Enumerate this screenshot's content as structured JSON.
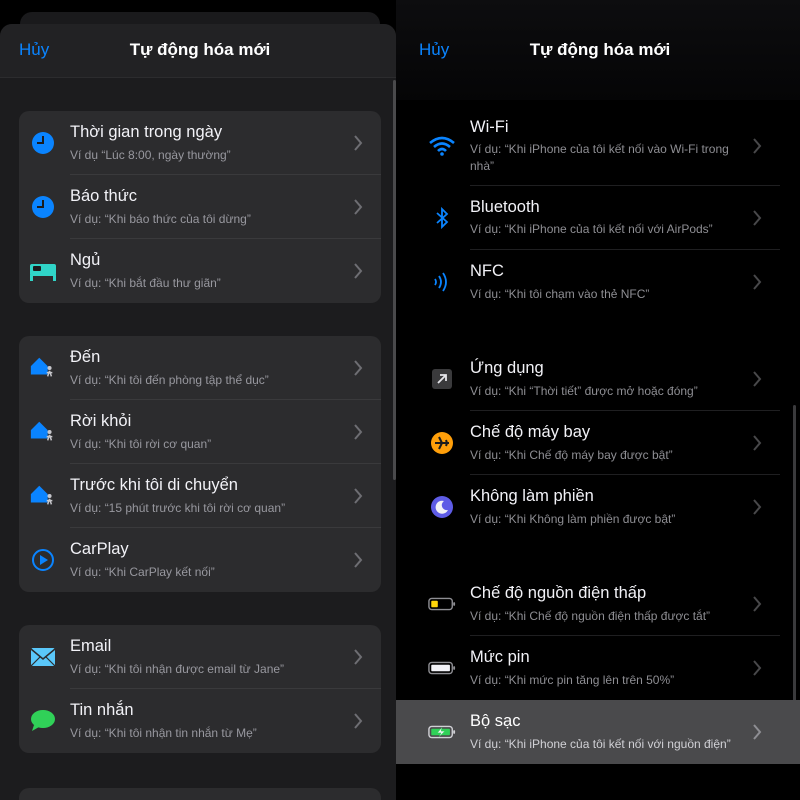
{
  "left": {
    "nav": {
      "cancel": "Hủy",
      "title": "Tự động hóa mới"
    },
    "groups": [
      [
        {
          "label": "Thời gian trong ngày",
          "sub": "Ví dụ “Lúc 8:00, ngày thường”",
          "icon": "clock-icon"
        },
        {
          "label": "Báo thức",
          "sub": "Ví dụ: “Khi báo thức của tôi dừng”",
          "icon": "clock-icon"
        },
        {
          "label": "Ngủ",
          "sub": "Ví dụ: “Khi bắt đầu thư giãn”",
          "icon": "bed-icon"
        }
      ],
      [
        {
          "label": "Đến",
          "sub": "Ví dụ: “Khi tôi đến phòng tập thể dục”",
          "icon": "home-person-icon"
        },
        {
          "label": "Rời khỏi",
          "sub": "Ví dụ: “Khi tôi rời cơ quan”",
          "icon": "home-person-icon"
        },
        {
          "label": "Trước khi tôi di chuyển",
          "sub": "Ví dụ: “15 phút trước khi tôi rời cơ quan”",
          "icon": "home-person-icon"
        },
        {
          "label": "CarPlay",
          "sub": "Ví dụ: “Khi CarPlay kết nối”",
          "icon": "carplay-icon"
        }
      ],
      [
        {
          "label": "Email",
          "sub": "Ví dụ: “Khi tôi nhận được email từ Jane”",
          "icon": "mail-icon"
        },
        {
          "label": "Tin nhắn",
          "sub": "Ví dụ: “Khi tôi nhận tin nhắn từ Mẹ”",
          "icon": "message-icon"
        }
      ]
    ]
  },
  "right": {
    "nav": {
      "cancel": "Hủy",
      "title": "Tự động hóa mới"
    },
    "items": [
      {
        "label": "Wi-Fi",
        "sub": "Ví dụ: “Khi iPhone của tôi kết nối vào Wi-Fi trong nhà”",
        "icon": "wifi-icon"
      },
      {
        "label": "Bluetooth",
        "sub": "Ví dụ: “Khi iPhone của tôi kết nối với AirPods”",
        "icon": "bluetooth-icon"
      },
      {
        "label": "NFC",
        "sub": "Ví dụ: “Khi tôi chạm vào thẻ NFC”",
        "icon": "nfc-icon"
      },
      {
        "label": "Ứng dụng",
        "sub": "Ví dụ: “Khi “Thời tiết” được mở hoặc đóng”",
        "icon": "app-arrow-icon"
      },
      {
        "label": "Chế độ máy bay",
        "sub": "Ví dụ: “Khi Chế độ máy bay được bật”",
        "icon": "airplane-icon"
      },
      {
        "label": "Không làm phiền",
        "sub": "Ví dụ: “Khi Không làm phiền được bật”",
        "icon": "moon-icon"
      },
      {
        "label": "Chế độ nguồn điện thấp",
        "sub": "Ví dụ: “Khi Chế độ nguồn điện thấp được tắt”",
        "icon": "low-battery-icon"
      },
      {
        "label": "Mức pin",
        "sub": "Ví dụ: “Khi mức pin tăng lên trên 50%”",
        "icon": "battery-icon"
      },
      {
        "label": "Bộ sạc",
        "sub": "Ví dụ: “Khi iPhone của tôi kết nối với nguồn điện”",
        "icon": "charging-battery-icon"
      }
    ]
  },
  "colors": {
    "accent": "#0a84ff",
    "bed": "#30d5c8",
    "message": "#30d158",
    "airplane": "#ff9f0a",
    "moon": "#5e5ce6"
  }
}
